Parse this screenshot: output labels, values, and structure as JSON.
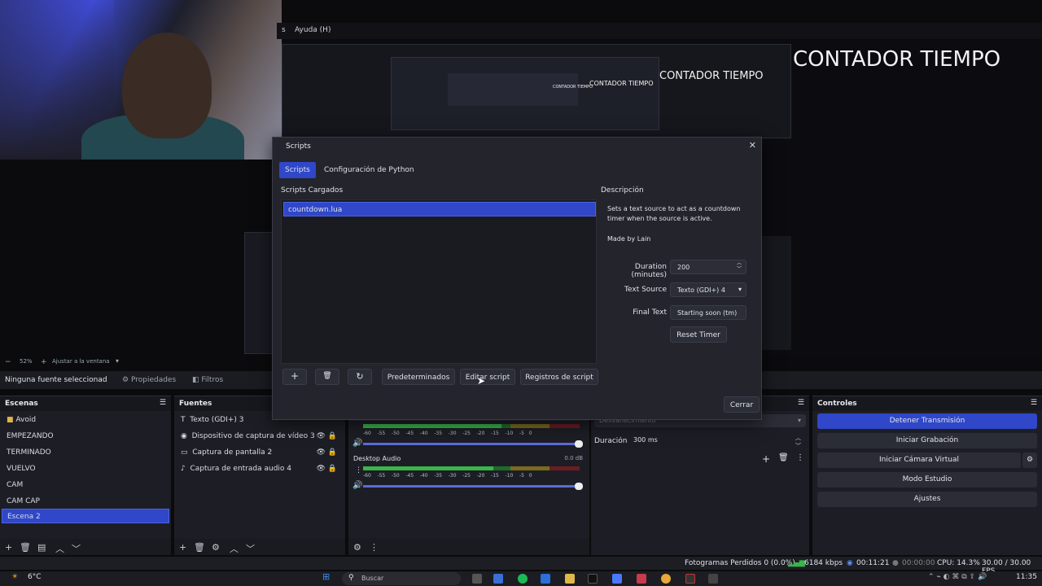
{
  "menubar": {
    "partial": "s",
    "help": "Ayuda (H)"
  },
  "preview": {
    "title_large": "CONTADOR TIEMPO",
    "title_medium": "CONTADOR TIEMPO",
    "title_small": "CONTADOR TIEMPO",
    "title_tiny": "CONTADOR TIEMPO"
  },
  "zoom": {
    "value": "52%",
    "fit": "Ajustar a la ventana"
  },
  "source_toolbar": {
    "no_source": "Ninguna fuente seleccionad",
    "properties": "Propiedades",
    "filters": "Filtros"
  },
  "dialog": {
    "title": "Scripts",
    "tabs": [
      "Scripts",
      "Configuración de Python"
    ],
    "loaded_label": "Scripts Cargados",
    "loaded_items": [
      "countdown.lua"
    ],
    "description_label": "Descripción",
    "description_text": "Sets a text source to act as a countdown timer when the source is active.",
    "made_by": "Made by Lain",
    "duration_label": "Duration (minutes)",
    "duration_value": "200",
    "text_source_label": "Text Source",
    "text_source_value": "Texto (GDI+) 4",
    "final_text_label": "Final Text",
    "final_text_value": "Starting soon (tm)",
    "reset_button": "Reset Timer",
    "defaults_button": "Predeterminados",
    "edit_button": "Editar script",
    "log_button": "Registros de script",
    "close_button": "Cerrar"
  },
  "scenes": {
    "title": "Escenas",
    "items": [
      "Avoid",
      "EMPEZANDO",
      "TERMINADO",
      "VUELVO",
      "CAM",
      "CAM CAP",
      "Escena 2"
    ],
    "selected": "Escena 2"
  },
  "sources": {
    "title": "Fuentes",
    "items": [
      "Texto (GDI+) 3",
      "Dispositivo de captura de vídeo 3",
      "Captura de pantalla 2",
      "Captura de entrada audio 4"
    ]
  },
  "mixer": {
    "ticks": [
      "-60",
      "-55",
      "-50",
      "-45",
      "-40",
      "-35",
      "-30",
      "-25",
      "-20",
      "-15",
      "-10",
      "-5",
      "0"
    ],
    "desktop_audio": "Desktop Audio",
    "desktop_db": "0.0 dB"
  },
  "transitions": {
    "faded": "Desvanecimiento",
    "duration_label": "Duración",
    "duration_value": "300 ms"
  },
  "controls": {
    "title": "Controles",
    "buttons": [
      "Detener Transmisión",
      "Iniciar Grabación",
      "Iniciar Cámara Virtual",
      "Modo Estudio",
      "Ajustes"
    ]
  },
  "status": {
    "dropped": "Fotogramas Perdidos 0 (0.0%)",
    "bitrate": "6184 kbps",
    "stream_time": "00:11:21",
    "rec_time": "00:00:00",
    "cpu": "CPU: 14.3%",
    "fps": "30.00 / 30.00 FPS"
  },
  "taskbar": {
    "weather": "6°C",
    "search": "Buscar",
    "clock": "11:35"
  }
}
